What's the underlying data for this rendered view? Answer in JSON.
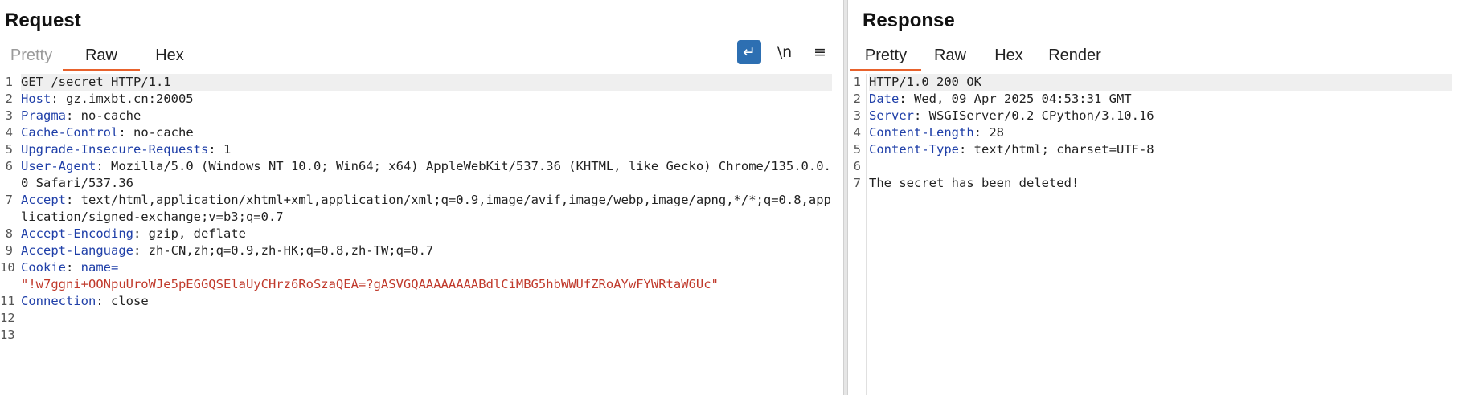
{
  "request": {
    "title": "Request",
    "tabs": [
      "Pretty",
      "Raw",
      "Hex"
    ],
    "active_tab": "Raw",
    "tools": [
      {
        "name": "word-wrap",
        "glyph": "↵",
        "active": true
      },
      {
        "name": "show-newlines",
        "glyph": "\\n",
        "active": false
      },
      {
        "name": "menu",
        "glyph": "≡",
        "active": false
      }
    ],
    "lines": [
      {
        "num": "1",
        "text": "GET /secret HTTP/1.1"
      },
      {
        "num": "2",
        "name": "Host",
        "value": " gz.imxbt.cn:20005"
      },
      {
        "num": "3",
        "name": "Pragma",
        "value": " no-cache"
      },
      {
        "num": "4",
        "name": "Cache-Control",
        "value": " no-cache"
      },
      {
        "num": "5",
        "name": "Upgrade-Insecure-Requests",
        "value": " 1"
      },
      {
        "num": "6",
        "name": "User-Agent",
        "value": " Mozilla/5.0 (Windows NT 10.0; Win64; x64) AppleWebKit/537.36 (KHTML, like Gecko) Chrome/135.0.0.0 Safari/537.36"
      },
      {
        "num": "7",
        "name": "Accept",
        "value": " text/html,application/xhtml+xml,application/xml;q=0.9,image/avif,image/webp,image/apng,*/*;q=0.8,application/signed-exchange;v=b3;q=0.7"
      },
      {
        "num": "8",
        "name": "Accept-Encoding",
        "value": " gzip, deflate"
      },
      {
        "num": "9",
        "name": "Accept-Language",
        "value": " zh-CN,zh;q=0.9,zh-HK;q=0.8,zh-TW;q=0.7"
      },
      {
        "num": "10",
        "name": "Cookie",
        "value": " name=",
        "cookie": "\"!w7ggni+OONpuUroWJe5pEGGQSElaUyCHrz6RoSzaQEA=?gASVGQAAAAAAAABdlCiMBG5hbWWUfZRoAYwFYWRtaW6Uc\""
      },
      {
        "num": "11",
        "name": "Connection",
        "value": " close"
      },
      {
        "num": "12",
        "text": ""
      },
      {
        "num": "13",
        "text": ""
      }
    ]
  },
  "response": {
    "title": "Response",
    "tabs": [
      "Pretty",
      "Raw",
      "Hex",
      "Render"
    ],
    "active_tab": "Pretty",
    "lines": [
      {
        "num": "1",
        "text": "HTTP/1.0 200 OK"
      },
      {
        "num": "2",
        "name": "Date",
        "value": " Wed, 09 Apr 2025 04:53:31 GMT"
      },
      {
        "num": "3",
        "name": "Server",
        "value": " WSGIServer/0.2 CPython/3.10.16"
      },
      {
        "num": "4",
        "name": "Content-Length",
        "value": " 28"
      },
      {
        "num": "5",
        "name": "Content-Type",
        "value": " text/html; charset=UTF-8"
      },
      {
        "num": "6",
        "text": ""
      },
      {
        "num": "7",
        "text": "The secret has been deleted!"
      }
    ]
  }
}
